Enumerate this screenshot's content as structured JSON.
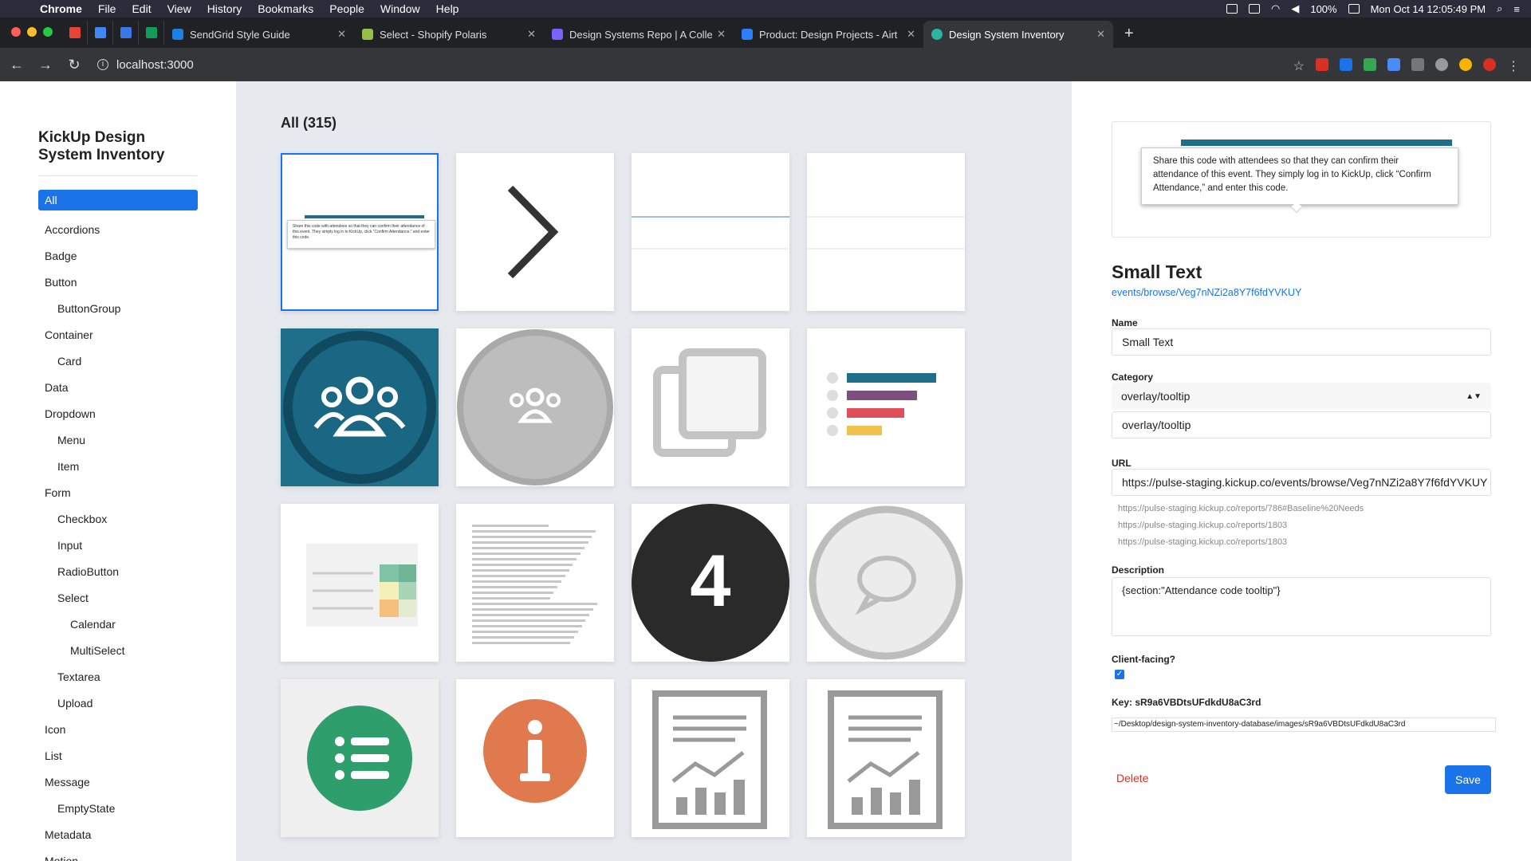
{
  "menubar": {
    "app": "Chrome",
    "items": [
      "File",
      "Edit",
      "View",
      "History",
      "Bookmarks",
      "People",
      "Window",
      "Help"
    ],
    "battery": "100%",
    "datetime": "Mon Oct 14  12:05:49 PM"
  },
  "tabs": [
    {
      "title": "SendGrid Style Guide",
      "color": "#1a82e2"
    },
    {
      "title": "Select - Shopify Polaris",
      "color": "#95bf47"
    },
    {
      "title": "Design Systems Repo | A Colle",
      "color": "#7b61ff"
    },
    {
      "title": "Product: Design Projects - Airt",
      "color": "#2d7ff9"
    },
    {
      "title": "Design System Inventory",
      "color": "#2bb3a3"
    }
  ],
  "new_tab": "+",
  "address": {
    "url": "localhost:3000"
  },
  "sidebar": {
    "brand": "KickUp Design System Inventory",
    "items": [
      {
        "label": "All",
        "level": 0,
        "active": true
      },
      {
        "label": "Accordions",
        "level": 0
      },
      {
        "label": "Badge",
        "level": 0
      },
      {
        "label": "Button",
        "level": 0
      },
      {
        "label": "ButtonGroup",
        "level": 1
      },
      {
        "label": "Container",
        "level": 0
      },
      {
        "label": "Card",
        "level": 1
      },
      {
        "label": "Data",
        "level": 0
      },
      {
        "label": "Dropdown",
        "level": 0
      },
      {
        "label": "Menu",
        "level": 1
      },
      {
        "label": "Item",
        "level": 1
      },
      {
        "label": "Form",
        "level": 0
      },
      {
        "label": "Checkbox",
        "level": 1
      },
      {
        "label": "Input",
        "level": 1
      },
      {
        "label": "RadioButton",
        "level": 1
      },
      {
        "label": "Select",
        "level": 1
      },
      {
        "label": "Calendar",
        "level": 2
      },
      {
        "label": "MultiSelect",
        "level": 2
      },
      {
        "label": "Textarea",
        "level": 1
      },
      {
        "label": "Upload",
        "level": 1
      },
      {
        "label": "Icon",
        "level": 0
      },
      {
        "label": "List",
        "level": 0
      },
      {
        "label": "Message",
        "level": 0
      },
      {
        "label": "EmptyState",
        "level": 1
      },
      {
        "label": "Metadata",
        "level": 0
      },
      {
        "label": "Motion",
        "level": 0
      }
    ]
  },
  "grid": {
    "title": "All (315)",
    "tiles": [
      {
        "kind": "tooltip",
        "selected": true
      },
      {
        "kind": "chevron"
      },
      {
        "kind": "hlines-blue"
      },
      {
        "kind": "hlines"
      },
      {
        "kind": "group-blue"
      },
      {
        "kind": "group-gray"
      },
      {
        "kind": "copy"
      },
      {
        "kind": "barlist"
      },
      {
        "kind": "table"
      },
      {
        "kind": "textlines"
      },
      {
        "kind": "number",
        "text": "4"
      },
      {
        "kind": "chat"
      },
      {
        "kind": "list-green"
      },
      {
        "kind": "info-orange"
      },
      {
        "kind": "report"
      },
      {
        "kind": "report"
      }
    ]
  },
  "detail": {
    "preview_text": "Share this code with attendees so that they can confirm their attendance of this event. They simply log in to KickUp, click “Confirm Attendance,” and enter this code.",
    "title": "Small Text",
    "link": "events/browse/Veg7nNZi2a8Y7f6fdYVKUY",
    "name_label": "Name",
    "name_value": "Small Text",
    "category_label": "Category",
    "category_select": "overlay/tooltip",
    "category_input": "overlay/tooltip",
    "url_label": "URL",
    "url_value": "https://pulse-staging.kickup.co/events/browse/Veg7nNZi2a8Y7f6fdYVKUY",
    "url_hints": [
      "https://pulse-staging.kickup.co/reports/786#Baseline%20Needs",
      "https://pulse-staging.kickup.co/reports/1803",
      "https://pulse-staging.kickup.co/reports/1803"
    ],
    "description_label": "Description",
    "description_value": "{section:\"Attendance code tooltip\"}",
    "client_label": "Client-facing?",
    "client_checked": true,
    "key_label": "Key: sR9a6VBDtsUFdkdU8aC3rd",
    "path_value": "~/Desktop/design-system-inventory-database/images/sR9a6VBDtsUFdkdU8aC3rd",
    "delete_label": "Delete",
    "save_label": "Save"
  },
  "colors": {
    "accent": "#1a73e8",
    "danger": "#d93025",
    "teal": "#1f6f8b"
  }
}
